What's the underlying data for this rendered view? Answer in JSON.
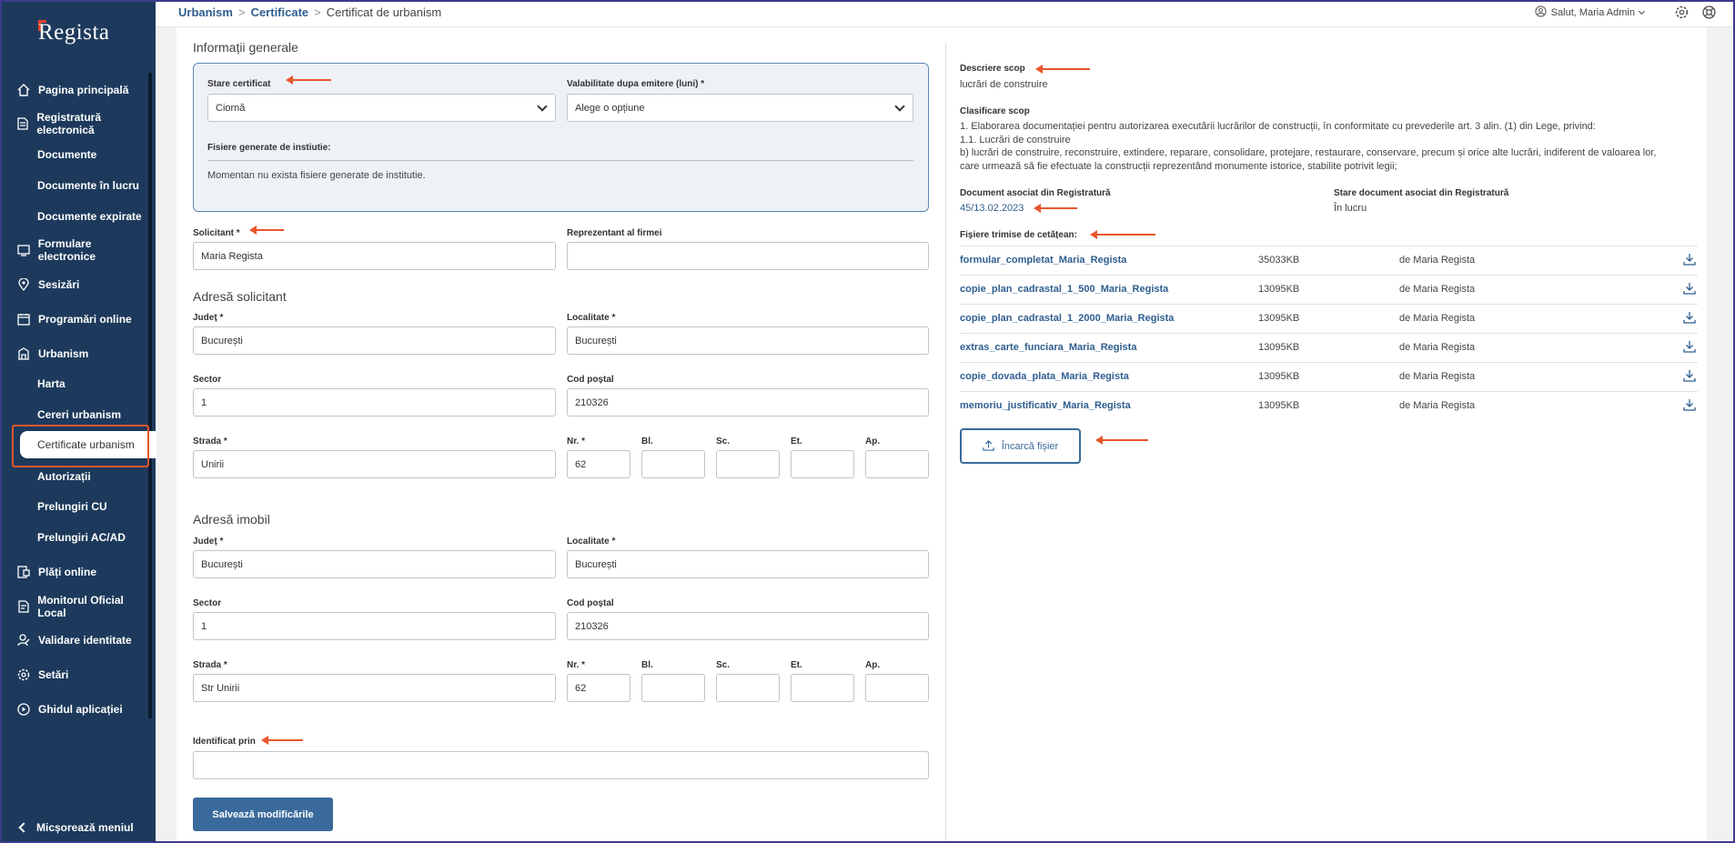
{
  "app": {
    "logo": "Regista"
  },
  "sidebar": {
    "items": [
      {
        "label": "Pagina principală",
        "icon": "home-icon"
      },
      {
        "label": "Registratură electronică",
        "icon": "document-icon"
      },
      {
        "label": "Formulare electronice",
        "icon": "form-icon"
      },
      {
        "label": "Sesizări",
        "icon": "pin-icon"
      },
      {
        "label": "Programări online",
        "icon": "calendar-icon"
      },
      {
        "label": "Urbanism",
        "icon": "building-icon"
      },
      {
        "label": "Plăți online",
        "icon": "payment-icon"
      },
      {
        "label": "Monitorul Oficial Local",
        "icon": "monitor-icon"
      },
      {
        "label": "Validare identitate",
        "icon": "user-check-icon"
      },
      {
        "label": "Setări",
        "icon": "gear-icon"
      },
      {
        "label": "Ghidul aplicației",
        "icon": "play-icon"
      }
    ],
    "registratura_sub": [
      "Documente",
      "Documente în lucru",
      "Documente expirate"
    ],
    "urbanism_sub": [
      "Harta",
      "Cereri urbanism",
      "Certificate urbanism",
      "Autorizații",
      "Prelungiri CU",
      "Prelungiri AC/AD"
    ],
    "collapse_label": "Micșorează meniul"
  },
  "topbar": {
    "crumb1": "Urbanism",
    "crumb2": "Certificate",
    "crumb3": "Certificat de urbanism",
    "user": "Salut, Maria Admin"
  },
  "general": {
    "title": "Informații generale",
    "stare_label": "Stare certificat",
    "stare_value": "Ciornă",
    "valab_label": "Valabilitate dupa emitere (luni) *",
    "valab_value": "Alege o opțiune",
    "fisiere_label": "Fisiere generate de instiutie:",
    "fisiere_empty": "Momentan nu exista fisiere generate de institutie."
  },
  "solicitant": {
    "label": "Solicitant *",
    "value": "Maria Regista",
    "repr_label": "Reprezentant al firmei",
    "repr_value": ""
  },
  "adresa_solicitant": {
    "title": "Adresă solicitant",
    "judet_label": "Județ *",
    "judet": "București",
    "loc_label": "Localitate *",
    "loc": "București",
    "sector_label": "Sector",
    "sector": "1",
    "cod_label": "Cod poștal",
    "cod": "210326",
    "strada_label": "Strada *",
    "strada": "Unirii",
    "nr_label": "Nr. *",
    "nr": "62",
    "bl_label": "Bl.",
    "sc_label": "Sc.",
    "et_label": "Et.",
    "ap_label": "Ap."
  },
  "adresa_imobil": {
    "title": "Adresă imobil",
    "judet_label": "Județ *",
    "judet": "București",
    "loc_label": "Localitate *",
    "loc": "București",
    "sector_label": "Sector",
    "sector": "1",
    "cod_label": "Cod poștal",
    "cod": "210326",
    "strada_label": "Strada *",
    "strada": "Str Unirii",
    "nr_label": "Nr. *",
    "nr": "62",
    "bl_label": "Bl.",
    "sc_label": "Sc.",
    "et_label": "Et.",
    "ap_label": "Ap."
  },
  "identificat": {
    "label": "Identificat prin",
    "value": ""
  },
  "save_label": "Salvează modificările",
  "right": {
    "scop_label": "Descriere scop",
    "scop_value": "lucrări de construire",
    "clasif_label": "Clasificare scop",
    "clasif_1": "1. Elaborarea documentației pentru autorizarea executării lucrărilor de construcții, în conformitate cu prevederile art. 3 alin. (1) din Lege, privind:",
    "clasif_2": "1.1. Lucrări de construire",
    "clasif_3": "b) lucrări de construire, reconstruire, extindere, reparare, consolidare, protejare, restaurare, conservare, precum și orice alte lucrări, indiferent de valoarea lor,",
    "clasif_4": "care urmează să fie efectuate la construcții reprezentând monumente istorice, stabilite potrivit legii;",
    "doc_label": "Document asociat din Registratură",
    "doc_value": "45/13.02.2023",
    "stare_doc_label": "Stare document asociat din Registratură",
    "stare_doc_value": "În lucru",
    "files_label": "Fișiere trimise de cetățean:",
    "files": [
      {
        "name": "formular_completat_Maria_Regista",
        "size": "35033KB",
        "by": "de Maria Regista"
      },
      {
        "name": "copie_plan_cadrastal_1_500_Maria_Regista",
        "size": "13095KB",
        "by": "de Maria Regista"
      },
      {
        "name": "copie_plan_cadrastal_1_2000_Maria_Regista",
        "size": "13095KB",
        "by": "de Maria Regista"
      },
      {
        "name": "extras_carte_funciara_Maria_Regista",
        "size": "13095KB",
        "by": "de Maria Regista"
      },
      {
        "name": "copie_dovada_plata_Maria_Regista",
        "size": "13095KB",
        "by": "de Maria Regista"
      },
      {
        "name": "memoriu_justificativ_Maria_Regista",
        "size": "13095KB",
        "by": "de Maria Regista"
      }
    ],
    "upload_label": "Încarcă fișier"
  },
  "colors": {
    "sidebar": "#1d3a5c",
    "accent": "#3a6a9c",
    "annotation": "#e8562b"
  }
}
